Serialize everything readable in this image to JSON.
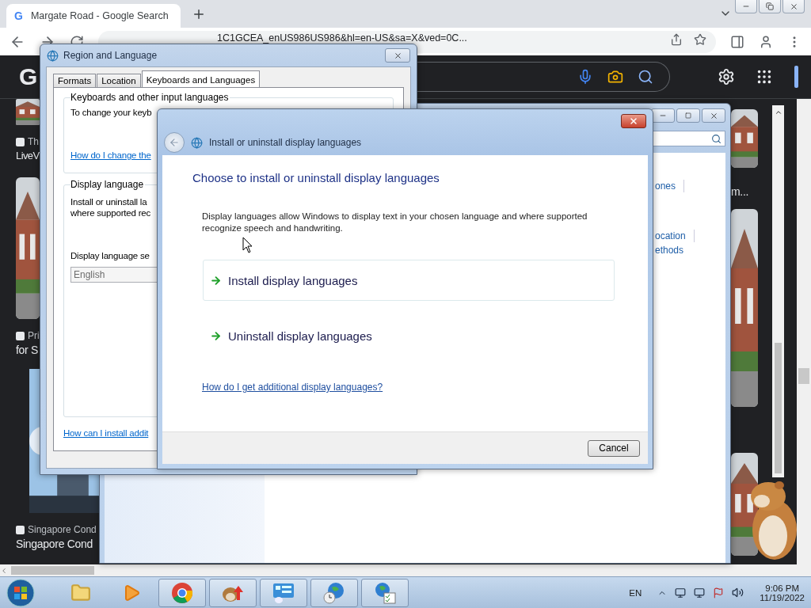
{
  "browser": {
    "tab": {
      "favicon": "G",
      "title": "Margate Road - Google Search"
    },
    "address": "1C1GCEA_enUS986US986&hl=en-US&sa=X&ved=0C...",
    "logo": "G",
    "left_results": [
      {
        "source": "Th",
        "title": "LiveV"
      },
      {
        "source": "Pri",
        "title": "for S"
      },
      {
        "source": "Singapore Cond",
        "title": "Singapore Cond"
      }
    ],
    "right_results": [
      {
        "title": "m..."
      }
    ]
  },
  "control_panel": {
    "links": [
      {
        "label": "ones",
        "divider": true
      },
      {
        "label": "ocation",
        "divider": true
      },
      {
        "label": "ethods",
        "divider": false
      }
    ]
  },
  "region_dialog": {
    "title": "Region and Language",
    "tabs": [
      {
        "label": "Formats",
        "selected": false
      },
      {
        "label": "Location",
        "selected": false
      },
      {
        "label": "Keyboards and Languages",
        "selected": true
      }
    ],
    "keyboards_group": {
      "heading": "Keyboards and other input languages",
      "text": "To change your keyb",
      "link": "How do I change the"
    },
    "display_group": {
      "heading": "Display language",
      "text_lines": [
        "Install or uninstall la",
        "where supported rec"
      ],
      "select_label": "Display language se",
      "select_value": "English"
    },
    "footer_link": "How can I install addit"
  },
  "install_dialog": {
    "title": "Install or uninstall display languages",
    "heading": "Choose to install or uninstall display languages",
    "description": "Display languages allow Windows to display text in your chosen language and where supported recognize speech and handwriting.",
    "commands": [
      {
        "label": "Install display languages",
        "hovered": true
      },
      {
        "label": "Uninstall display languages",
        "hovered": false
      }
    ],
    "help_link": "How do I get additional display languages?",
    "buttons": [
      "Cancel"
    ]
  },
  "taskbar": {
    "apps": [
      {
        "kind": "folder",
        "open": false
      },
      {
        "kind": "media",
        "open": false
      },
      {
        "kind": "chrome",
        "open": true
      },
      {
        "kind": "hamster",
        "open": true
      },
      {
        "kind": "control-panel",
        "open": true
      },
      {
        "kind": "globe-clock",
        "open": true
      },
      {
        "kind": "globe-check",
        "open": true
      }
    ],
    "language": "EN",
    "time": "9:06 PM",
    "date": "11/19/2022"
  }
}
